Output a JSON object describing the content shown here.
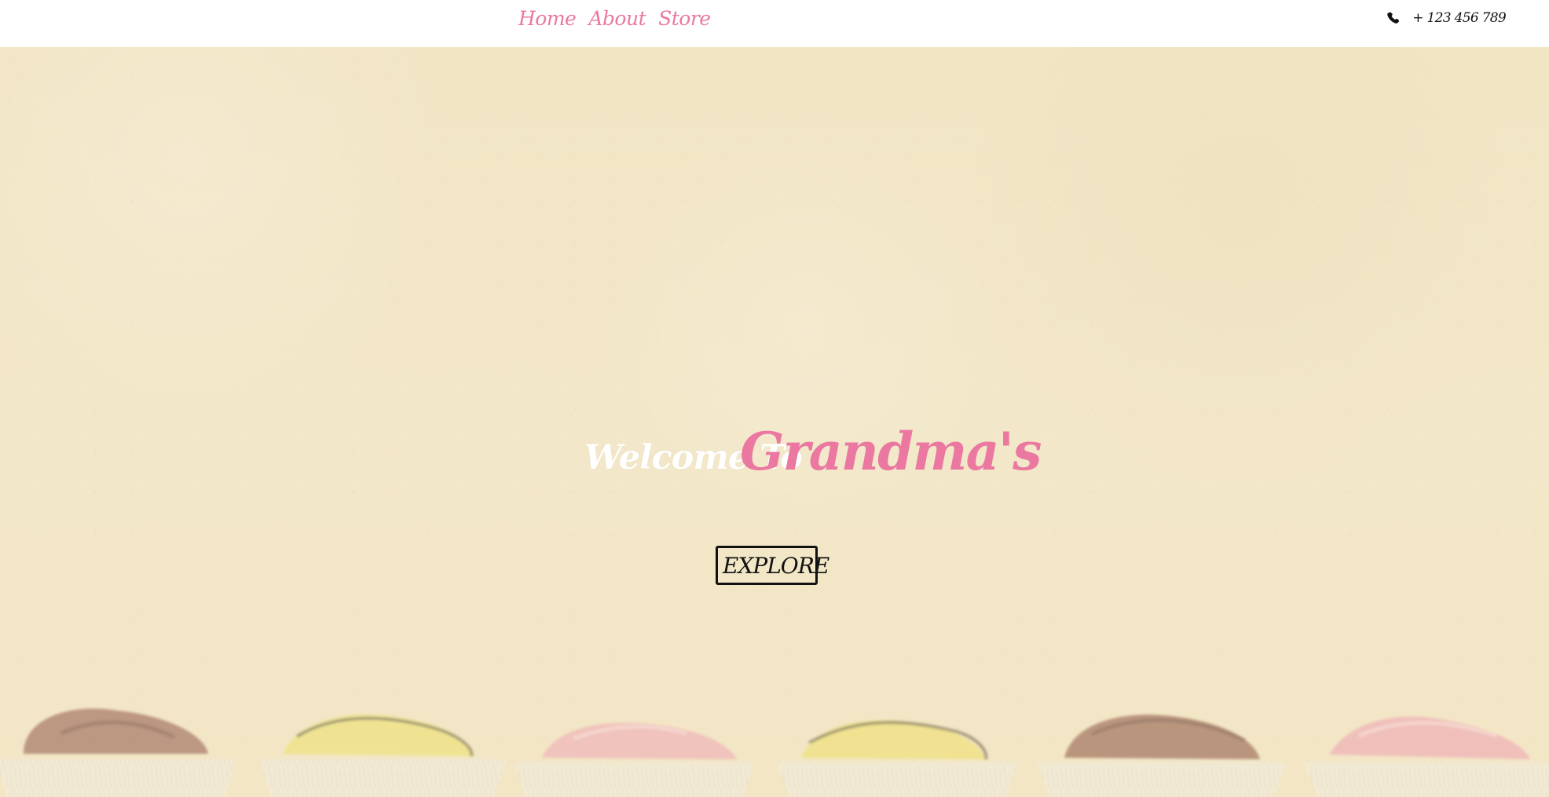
{
  "navigation": {
    "items": [
      {
        "label": "Home"
      },
      {
        "label": "About"
      },
      {
        "label": "Store"
      }
    ],
    "phone": {
      "icon": "phone-icon",
      "number": "+ 123 456 789"
    }
  },
  "hero": {
    "welcome_text": "Welcome To",
    "brand_name": "Grandma's",
    "explore_label": "EXPLORE"
  },
  "colors": {
    "accent_pink": "#ea78a0",
    "dark_text": "#111111",
    "hero_background": "#f1e5c4"
  }
}
